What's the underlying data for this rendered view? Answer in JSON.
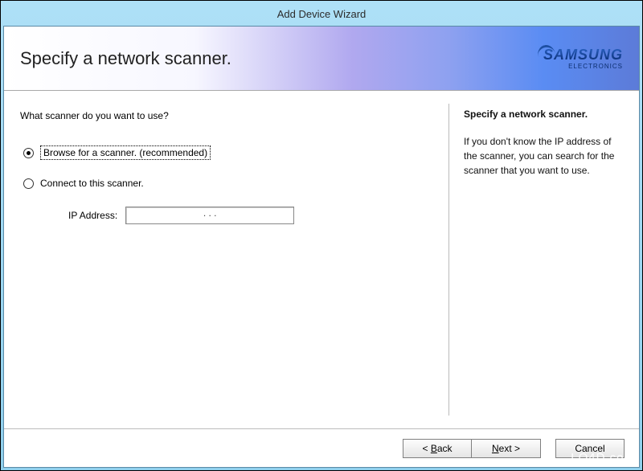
{
  "window": {
    "title": "Add Device Wizard"
  },
  "banner": {
    "title": "Specify a network scanner."
  },
  "brand": {
    "name": "SAMSUNG",
    "sub": "ELECTRONICS"
  },
  "main": {
    "question": "What scanner do you want to use?",
    "radio_browse": "Browse for a scanner. (recommended)",
    "radio_connect": "Connect to this scanner.",
    "ip_label": "IP Address:",
    "ip_value": "       .             .             .       "
  },
  "side": {
    "title": "Specify a network scanner.",
    "body": "If you don't know the IP address of the scanner, you can search for the scanner that you want to use."
  },
  "buttons": {
    "back_full": "< Back",
    "next_full": "Next >",
    "cancel": "Cancel"
  },
  "watermark": "LO4D.com"
}
